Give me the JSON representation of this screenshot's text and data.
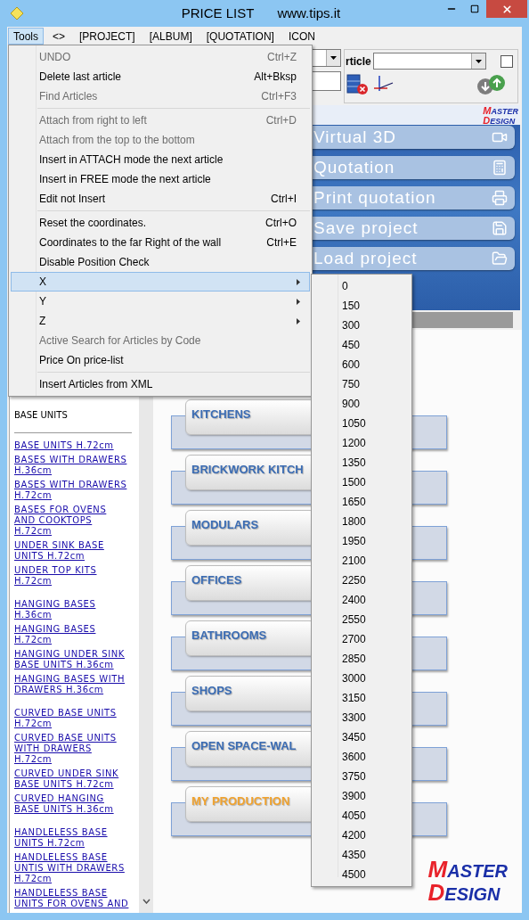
{
  "window": {
    "title": "PRICE LIST",
    "subtitle": "www.tips.it"
  },
  "menu_bar": [
    {
      "label": "Tools",
      "selected": true
    },
    {
      "label": "<>",
      "selected": false
    },
    {
      "label": "[PROJECT]",
      "selected": false
    },
    {
      "label": "[ALBUM]",
      "selected": false
    },
    {
      "label": "[QUOTATION]",
      "selected": false
    },
    {
      "label": "ICON",
      "selected": false
    }
  ],
  "toolbar": {
    "article_label": "rticle",
    "option_checkbox": {
      "checked": false
    }
  },
  "side_panel": {
    "logo": [
      "MASTER",
      "DESIGN"
    ],
    "buttons": [
      "Virtual 3D",
      "Quotation",
      "Print quotation",
      "Save project",
      "Load project"
    ]
  },
  "left_list": {
    "heading": "BASE UNITS",
    "groups": [
      [
        "BASE UNITS H.72cm",
        "BASES WITH DRAWERS H.36cm",
        "BASES WITH DRAWERS H.72cm",
        "BASES FOR OVENS AND COOKTOPS H.72cm",
        "UNDER SINK BASE UNITS H.72cm",
        "UNDER TOP KITS H.72cm"
      ],
      [
        "HANGING BASES H.36cm",
        "HANGING BASES H.72cm",
        "HANGING UNDER SINK BASE UNITS H.36cm",
        "HANGING BASES WITH DRAWERS H.36cm"
      ],
      [
        "CURVED BASE UNITS H.72cm",
        "CURVED BASE UNITS WITH DRAWERS H.72cm",
        "CURVED UNDER SINK BASE UNITS H.72cm",
        "CURVED HANGING BASE UNITS H.36cm"
      ],
      [
        "HANDLELESS BASE UNITS H.72cm",
        "HANDLELESS BASE UNTIS WITH DRAWERS H.72cm",
        "HANDLELESS BASE UNITS FOR OVENS AND"
      ]
    ]
  },
  "categories": [
    {
      "label": "KITCHENS",
      "color": "#3b6cb3"
    },
    {
      "label": "BRICKWORK KITCH",
      "color": "#3b6cb3"
    },
    {
      "label": "MODULARS",
      "color": "#3b6cb3"
    },
    {
      "label": "OFFICES",
      "color": "#3b6cb3"
    },
    {
      "label": "BATHROOMS",
      "color": "#3b6cb3"
    },
    {
      "label": "SHOPS",
      "color": "#3b6cb3"
    },
    {
      "label": "OPEN SPACE-WAL",
      "color": "#3b6cb3"
    },
    {
      "label": "MY PRODUCTION",
      "color": "#f0a22e"
    }
  ],
  "bottom_logo": [
    "MASTER",
    "DESIGN"
  ],
  "tools_menu": {
    "items": [
      {
        "kind": "item",
        "label": "UNDO",
        "shortcut": "Ctrl+Z",
        "disabled": true,
        "selected": false
      },
      {
        "kind": "item",
        "label": "Delete last article",
        "shortcut": "Alt+Bksp",
        "disabled": false,
        "selected": false
      },
      {
        "kind": "item",
        "label": "Find Articles",
        "shortcut": "Ctrl+F3",
        "disabled": true,
        "selected": false
      },
      {
        "kind": "separator"
      },
      {
        "kind": "item",
        "label": "Attach from right to left",
        "shortcut": "Ctrl+D",
        "disabled": true,
        "selected": false
      },
      {
        "kind": "item",
        "label": "Attach from the top to the bottom",
        "disabled": true,
        "selected": false
      },
      {
        "kind": "item",
        "label": "Insert in ATTACH mode the next article",
        "disabled": false,
        "selected": false
      },
      {
        "kind": "item",
        "label": "Insert in FREE mode the next article",
        "disabled": false,
        "selected": false
      },
      {
        "kind": "item",
        "label": "Edit not Insert",
        "shortcut": "Ctrl+I",
        "disabled": false,
        "selected": false
      },
      {
        "kind": "separator"
      },
      {
        "kind": "item",
        "label": "Reset the coordinates.",
        "shortcut": "Ctrl+O",
        "disabled": false,
        "selected": false
      },
      {
        "kind": "item",
        "label": "Coordinates to the far Right of the wall",
        "shortcut": "Ctrl+E",
        "disabled": false,
        "selected": false
      },
      {
        "kind": "item",
        "label": "Disable Position Check",
        "disabled": false,
        "selected": false
      },
      {
        "kind": "submenu",
        "label": "X",
        "disabled": false,
        "selected": true
      },
      {
        "kind": "submenu",
        "label": "Y",
        "disabled": false,
        "selected": false
      },
      {
        "kind": "submenu",
        "label": "Z",
        "disabled": false,
        "selected": false
      },
      {
        "kind": "item",
        "label": "Active Search for Articles by Code",
        "disabled": true,
        "selected": false
      },
      {
        "kind": "item",
        "label": "Price On price-list",
        "disabled": false,
        "selected": false
      },
      {
        "kind": "separator"
      },
      {
        "kind": "item",
        "label": "Insert Articles from XML",
        "disabled": false,
        "selected": false
      }
    ]
  },
  "x_submenu": [
    "0",
    "150",
    "300",
    "450",
    "600",
    "750",
    "900",
    "1050",
    "1200",
    "1350",
    "1500",
    "1650",
    "1800",
    "1950",
    "2100",
    "2250",
    "2400",
    "2550",
    "2700",
    "2850",
    "3000",
    "3150",
    "3300",
    "3450",
    "3600",
    "3750",
    "3900",
    "4050",
    "4200",
    "4350",
    "4500"
  ]
}
